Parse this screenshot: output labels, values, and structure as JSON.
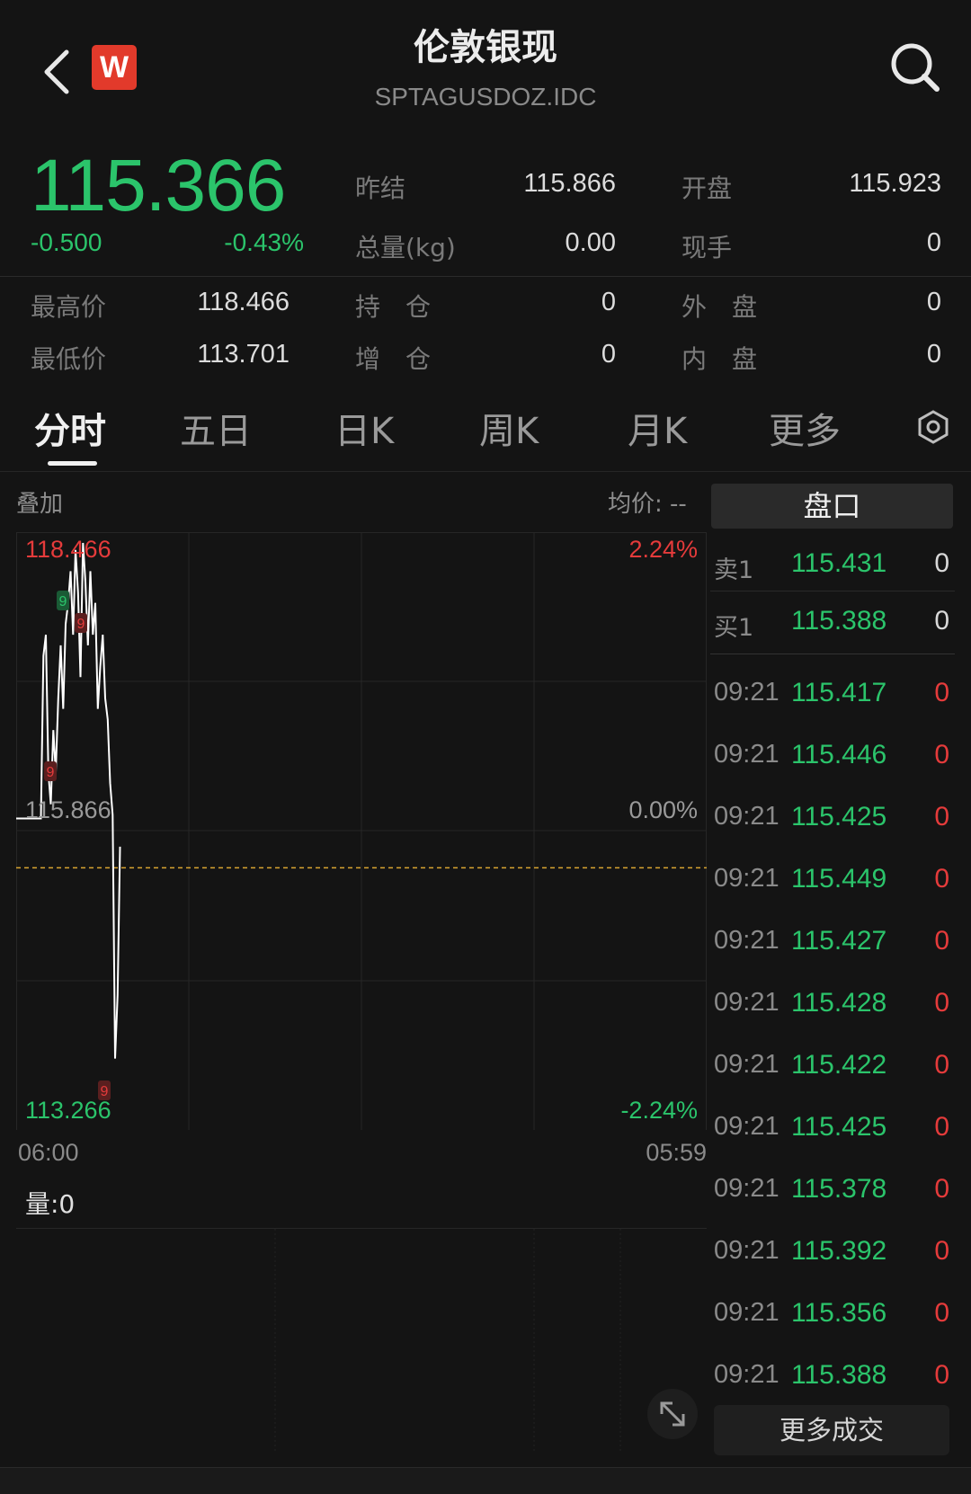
{
  "header": {
    "title": "伦敦银现",
    "symbol": "SPTAGUSDOZ.IDC",
    "logo_letter": "W"
  },
  "quote": {
    "price": "115.366",
    "change": "-0.500",
    "change_pct": "-0.43%",
    "fields": [
      {
        "label": "昨结",
        "value": "115.866"
      },
      {
        "label": "开盘",
        "value": "115.923"
      },
      {
        "label": "总量(kg)",
        "value": "0.00"
      },
      {
        "label": "现手",
        "value": "0"
      },
      {
        "label": "最高价",
        "value": "118.466"
      },
      {
        "label": "持　仓",
        "value": "0"
      },
      {
        "label": "外　盘",
        "value": "0"
      },
      {
        "label": "最低价",
        "value": "113.701"
      },
      {
        "label": "增　仓",
        "value": "0"
      },
      {
        "label": "内　盘",
        "value": "0"
      }
    ]
  },
  "tabs": [
    "分时",
    "五日",
    "日K",
    "周K",
    "月K",
    "更多"
  ],
  "chart": {
    "overlay_label": "叠加",
    "avg_label": "均价: --",
    "price_high": "118.466",
    "price_ref": "115.866",
    "price_low": "113.266",
    "pct_high": "2.24%",
    "pct_ref": "0.00%",
    "pct_low": "-2.24%",
    "time_start": "06:00",
    "time_end": "05:59",
    "volume_label": "量:0",
    "marker": "9",
    "colors": {
      "up": "#e53b3b",
      "down": "#2bc46b",
      "line": "#ffffff",
      "avg": "#d9a531"
    }
  },
  "chart_data": {
    "type": "line",
    "ylim": [
      113.266,
      118.466
    ],
    "reference": 115.866,
    "avg_line": 115.4,
    "points": [
      115.866,
      115.866,
      115.866,
      115.866,
      115.866,
      115.866,
      115.866,
      115.866,
      115.866,
      115.866,
      115.866,
      117.4,
      117.6,
      116.3,
      116.0,
      116.7,
      116.3,
      117.0,
      117.5,
      116.9,
      117.7,
      117.9,
      118.2,
      117.6,
      118.4,
      118.0,
      117.2,
      118.466,
      118.1,
      117.5,
      118.2,
      117.6,
      117.9,
      116.9,
      117.3,
      117.6,
      117.0,
      116.8,
      116.2,
      115.9,
      113.6,
      114.2,
      115.6
    ]
  },
  "orderbook": {
    "tab_label": "盘口",
    "rows": [
      {
        "side": "卖1",
        "price": "115.431",
        "qty": "0"
      },
      {
        "side": "买1",
        "price": "115.388",
        "qty": "0"
      }
    ]
  },
  "trades": [
    {
      "time": "09:21",
      "price": "115.417",
      "qty": "0"
    },
    {
      "time": "09:21",
      "price": "115.446",
      "qty": "0"
    },
    {
      "time": "09:21",
      "price": "115.425",
      "qty": "0"
    },
    {
      "time": "09:21",
      "price": "115.449",
      "qty": "0"
    },
    {
      "time": "09:21",
      "price": "115.427",
      "qty": "0"
    },
    {
      "time": "09:21",
      "price": "115.428",
      "qty": "0"
    },
    {
      "time": "09:21",
      "price": "115.422",
      "qty": "0"
    },
    {
      "time": "09:21",
      "price": "115.425",
      "qty": "0"
    },
    {
      "time": "09:21",
      "price": "115.378",
      "qty": "0"
    },
    {
      "time": "09:21",
      "price": "115.392",
      "qty": "0"
    },
    {
      "time": "09:21",
      "price": "115.356",
      "qty": "0"
    },
    {
      "time": "09:21",
      "price": "115.388",
      "qty": "0"
    }
  ],
  "more_trades_label": "更多成交",
  "icons": {
    "back": "chevron-left-icon",
    "search": "search-icon",
    "settings": "hexagon-settings-icon",
    "expand": "expand-diagonal-icon"
  }
}
